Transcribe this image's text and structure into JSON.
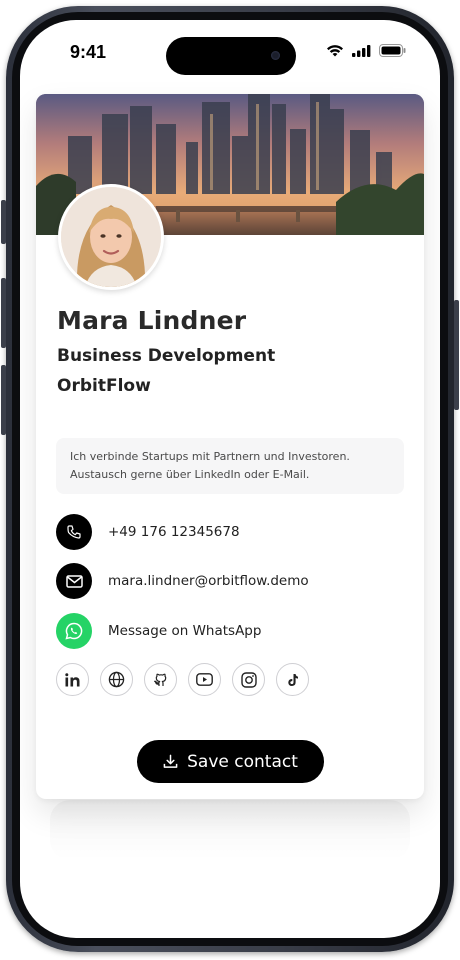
{
  "status_bar": {
    "time": "9:41",
    "icons": [
      "signal-wifi-icon",
      "cellular-signal-icon",
      "battery-icon"
    ]
  },
  "profile": {
    "name": "Mara Lindner",
    "role": "Business Development",
    "company": "OrbitFlow",
    "bio_line1": "Ich verbinde Startups mit Partnern und Investoren.",
    "bio_line2": "Austausch gerne über LinkedIn oder E-Mail."
  },
  "contacts": {
    "phone": "+49 176 12345678",
    "email": "mara.lindner@orbitflow.demo",
    "whatsapp": "Message on WhatsApp"
  },
  "socials": [
    "linkedin-icon",
    "globe-icon",
    "github-icon",
    "youtube-icon",
    "instagram-icon",
    "tiktok-icon"
  ],
  "actions": {
    "save_label": "Save contact"
  },
  "colors": {
    "primary": "#000000",
    "whatsapp": "#25D366",
    "bio_bg": "#F6F6F7",
    "text": "#222222"
  }
}
